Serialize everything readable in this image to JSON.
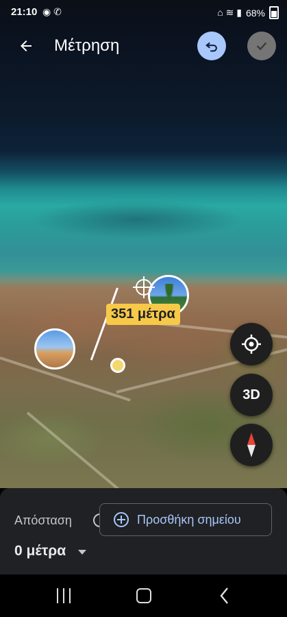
{
  "status": {
    "time": "21:10",
    "battery": "68%"
  },
  "header": {
    "title": "Μέτρηση"
  },
  "map": {
    "measurement_label": "351 μέτρα",
    "three_d_label": "3D"
  },
  "panel": {
    "distance_caption": "Απόσταση",
    "add_point_label": "Προσθήκη σημείου",
    "distance_value": "0 μέτρα"
  },
  "colors": {
    "accent": "#a8c7fa",
    "label_bg": "#f7c948",
    "panel_bg": "#202124"
  }
}
